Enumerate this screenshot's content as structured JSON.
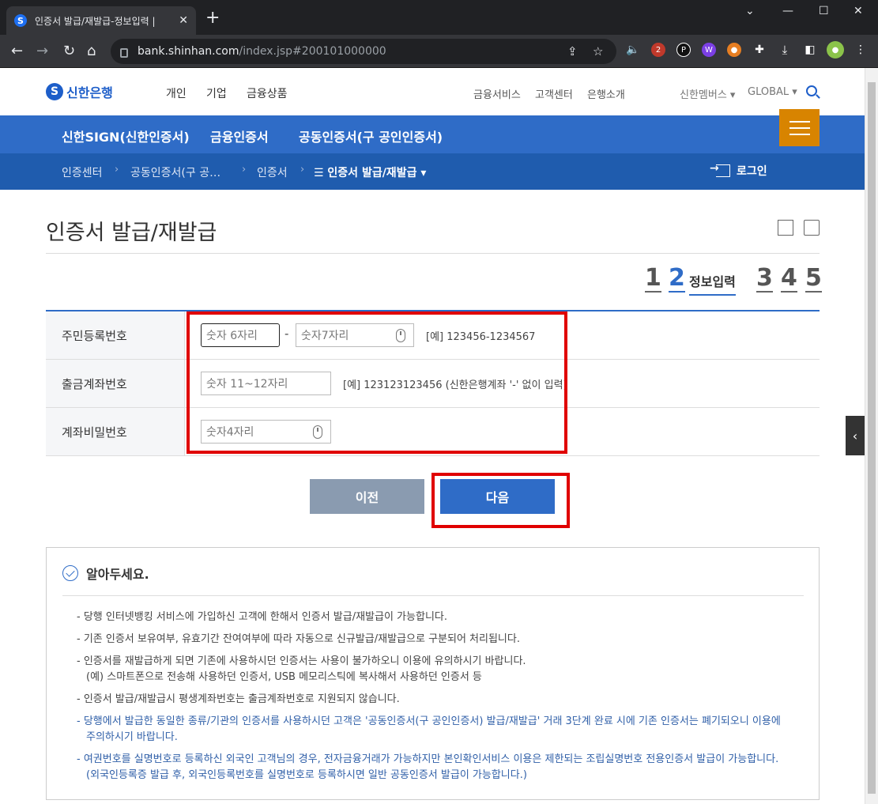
{
  "browser": {
    "tab_title": "인증서 발급/재발급-정보입력 |",
    "favicon": "S",
    "close": "✕",
    "new_tab": "+",
    "url_host": "bank.shinhan.com",
    "url_path": "/index.jsp#200101000000",
    "ext_badge": "2"
  },
  "header": {
    "logo_text": "신한은행",
    "main_nav": [
      "개인",
      "기업",
      "금융상품"
    ],
    "util_nav": [
      "금융서비스",
      "고객센터",
      "은행소개"
    ],
    "members": "신한멤버스 ▾",
    "global": "GLOBAL ▾"
  },
  "cert_menu": {
    "items": [
      "신한SIGN(신한인증서)",
      "금융인증서",
      "공동인증서(구 공인인증서)"
    ],
    "active_index": 2
  },
  "breadcrumb": {
    "items": [
      "인증센터",
      "공동인증서(구 공…",
      "인증서"
    ],
    "current": "☰ 인증서 발급/재발급 ▾",
    "login": "로그인"
  },
  "page": {
    "title": "인증서 발급/재발급"
  },
  "steps": {
    "numbers": [
      "1",
      "2",
      "3",
      "4",
      "5"
    ],
    "current": 2,
    "current_label": "정보입력"
  },
  "form": {
    "rows": [
      {
        "label": "주민등록번호",
        "front_placeholder": "숫자 6자리",
        "back_placeholder": "숫자7자리",
        "hint": "[예] 123456-1234567"
      },
      {
        "label": "출금계좌번호",
        "placeholder": "숫자 11~12자리",
        "hint": "[예] 123123123456 (신한은행계좌 '-' 없이 입력)"
      },
      {
        "label": "계좌비밀번호",
        "placeholder": "숫자4자리"
      }
    ],
    "separator": "-"
  },
  "buttons": {
    "prev": "이전",
    "next": "다음"
  },
  "notice": {
    "title": "알아두세요.",
    "items": [
      {
        "text": "- 당행 인터넷뱅킹 서비스에 가입하신 고객에 한해서 인증서 발급/재발급이 가능합니다.",
        "sub": "",
        "emphasis": false
      },
      {
        "text": "- 기존 인증서 보유여부, 유효기간 잔여여부에 따라 자동으로 신규발급/재발급으로 구분되어 처리됩니다.",
        "sub": "",
        "emphasis": false
      },
      {
        "text": "- 인증서를 재발급하게 되면 기존에 사용하시던 인증서는 사용이 불가하오니 이용에 유의하시기 바랍니다.",
        "sub": "(예) 스마트폰으로 전송해 사용하던 인증서, USB 메모리스틱에 복사해서 사용하던 인증서 등",
        "emphasis": false
      },
      {
        "text": "- 인증서 발급/재발급시 평생계좌번호는 출금계좌번호로 지원되지 않습니다.",
        "sub": "",
        "emphasis": false
      },
      {
        "text": "- 당행에서 발급한 동일한 종류/기관의 인증서를 사용하시던 고객은 '공동인증서(구 공인인증서) 발급/재발급' 거래 3단계 완료 시에 기존 인증서는 폐기되오니 이용에 주의하시기 바랍니다.",
        "sub": "",
        "emphasis": true
      },
      {
        "text": "- 여권번호를 실명번호로 등록하신 외국인 고객님의 경우, 전자금융거래가 가능하지만 본인확인서비스 이용은 제한되는 조립실명번호 전용인증서 발급이 가능합니다. (외국인등록증 발급 후, 외국인등록번호를 실명번호로 등록하시면 일반 공동인증서 발급이 가능합니다.)",
        "sub": "",
        "emphasis": true
      }
    ]
  },
  "colors": {
    "brand_blue": "#2f6cc7",
    "breadcrumb_blue": "#1f5cae",
    "menu_orange": "#d88400",
    "highlight_red": "#e00000"
  }
}
